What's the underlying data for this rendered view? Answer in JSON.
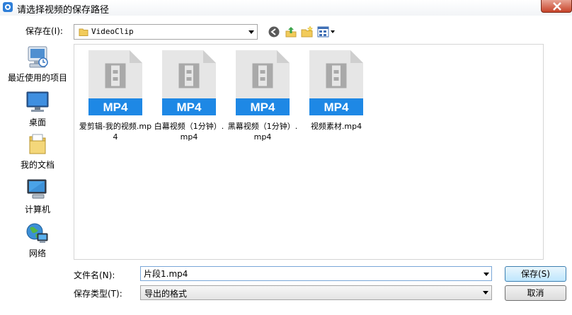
{
  "window": {
    "title": "请选择视频的保存路径"
  },
  "lookin": {
    "label": "保存在(I):",
    "value": "VideoClip"
  },
  "places": [
    {
      "label": "最近使用的项目",
      "icon": "recent-items-icon"
    },
    {
      "label": "桌面",
      "icon": "desktop-icon"
    },
    {
      "label": "我的文档",
      "icon": "documents-icon"
    },
    {
      "label": "计算机",
      "icon": "computer-icon"
    },
    {
      "label": "网络",
      "icon": "network-icon"
    }
  ],
  "files": [
    {
      "badge": "MP4",
      "name": "爱剪辑-我的视频.mp4"
    },
    {
      "badge": "MP4",
      "name": "白幕视频（1分钟）.mp4"
    },
    {
      "badge": "MP4",
      "name": "黑幕视频（1分钟）.mp4"
    },
    {
      "badge": "MP4",
      "name": "视频素材.mp4"
    }
  ],
  "filename": {
    "label": "文件名(N):",
    "value": "片段1.mp4"
  },
  "filetype": {
    "label": "保存类型(T):",
    "value": "导出的格式"
  },
  "buttons": {
    "save": "保存(S)",
    "cancel": "取消"
  },
  "colors": {
    "badge_blue": "#1e88e5",
    "file_gray": "#e6e6e6"
  }
}
